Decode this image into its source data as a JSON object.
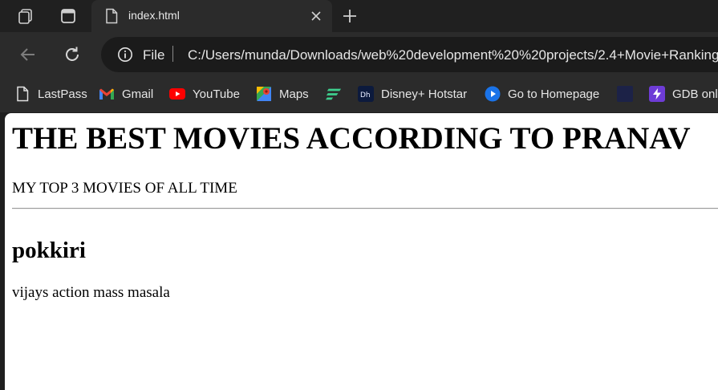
{
  "browser": {
    "tab": {
      "title": "index.html"
    },
    "address_bar": {
      "scheme_label": "File",
      "url": "C:/Users/munda/Downloads/web%20development%20%20projects/2.4+Movie+Ranking"
    },
    "bookmarks": [
      {
        "label": "LastPass",
        "icon": "document-icon"
      },
      {
        "label": "Gmail",
        "icon": "gmail-icon"
      },
      {
        "label": "YouTube",
        "icon": "youtube-icon"
      },
      {
        "label": "Maps",
        "icon": "maps-icon"
      },
      {
        "label": "",
        "icon": "stripes-icon"
      },
      {
        "label": "Disney+ Hotstar",
        "icon": "hotstar-icon"
      },
      {
        "label": "Go to Homepage",
        "icon": "play-circle-icon"
      },
      {
        "label": "",
        "icon": "dark-square-icon"
      },
      {
        "label": "GDB online",
        "icon": "bolt-icon"
      }
    ]
  },
  "page": {
    "heading": "THE BEST MOVIES ACCORDING TO PRANAV",
    "subheading": "MY TOP 3 MOVIES OF ALL TIME",
    "movie": {
      "title": "pokkiri",
      "description": "vijays action mass masala"
    }
  }
}
